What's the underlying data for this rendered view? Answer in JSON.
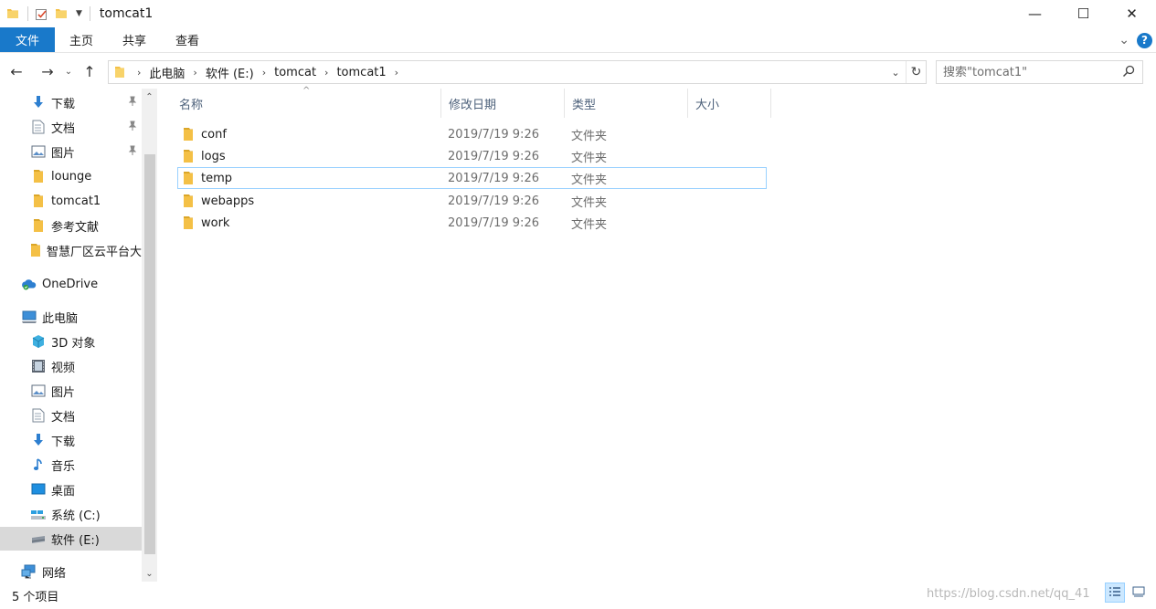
{
  "window": {
    "title": "tomcat1",
    "minimize_glyph": "—",
    "maximize_glyph": "☐",
    "close_glyph": "✕"
  },
  "ribbon": {
    "tabs": [
      {
        "label": "文件"
      },
      {
        "label": "主页"
      },
      {
        "label": "共享"
      },
      {
        "label": "查看"
      }
    ],
    "expand_glyph": "⌄",
    "help_glyph": "?"
  },
  "navigation": {
    "back_glyph": "←",
    "forward_glyph": "→",
    "recent_glyph": "⌄",
    "up_glyph": "↑"
  },
  "address": {
    "crumbs": [
      {
        "label": "此电脑"
      },
      {
        "label": "软件 (E:)"
      },
      {
        "label": "tomcat"
      },
      {
        "label": "tomcat1"
      }
    ],
    "separator": "›",
    "dropdown_glyph": "⌄",
    "refresh_glyph": "↻"
  },
  "search": {
    "placeholder": "搜索\"tomcat1\""
  },
  "sidebar": {
    "quick_access": [
      {
        "label": "下载",
        "icon": "download-icon",
        "pinned": true
      },
      {
        "label": "文档",
        "icon": "document-icon",
        "pinned": true
      },
      {
        "label": "图片",
        "icon": "picture-icon",
        "pinned": true
      },
      {
        "label": "lounge",
        "icon": "folder-icon"
      },
      {
        "label": "tomcat1",
        "icon": "folder-icon"
      },
      {
        "label": "参考文献",
        "icon": "folder-icon"
      },
      {
        "label": "智慧厂区云平台大",
        "icon": "folder-icon"
      }
    ],
    "onedrive": "OneDrive",
    "this_pc": "此电脑",
    "pc_items": [
      {
        "label": "3D 对象",
        "icon": "cube-icon"
      },
      {
        "label": "视频",
        "icon": "video-icon"
      },
      {
        "label": "图片",
        "icon": "picture-icon"
      },
      {
        "label": "文档",
        "icon": "document-icon"
      },
      {
        "label": "下载",
        "icon": "download-icon"
      },
      {
        "label": "音乐",
        "icon": "music-icon"
      },
      {
        "label": "桌面",
        "icon": "desktop-icon"
      },
      {
        "label": "系统 (C:)",
        "icon": "system-drive-icon"
      },
      {
        "label": "软件 (E:)",
        "icon": "drive-icon"
      }
    ],
    "network": "网络",
    "scroll_up_glyph": "⌃",
    "scroll_down_glyph": "⌄"
  },
  "columns": [
    {
      "label": "名称"
    },
    {
      "label": "修改日期"
    },
    {
      "label": "类型"
    },
    {
      "label": "大小"
    }
  ],
  "sort_glyph": "^",
  "files": [
    {
      "name": "conf",
      "date": "2019/7/19 9:26",
      "type": "文件夹"
    },
    {
      "name": "logs",
      "date": "2019/7/19 9:26",
      "type": "文件夹"
    },
    {
      "name": "temp",
      "date": "2019/7/19 9:26",
      "type": "文件夹"
    },
    {
      "name": "webapps",
      "date": "2019/7/19 9:26",
      "type": "文件夹"
    },
    {
      "name": "work",
      "date": "2019/7/19 9:26",
      "type": "文件夹"
    }
  ],
  "status": {
    "item_count": "5 个项目",
    "watermark": "https://blog.csdn.net/qq_41"
  },
  "colors": {
    "accent": "#1979ca",
    "folder": "#f4c046",
    "folder_dark": "#dba628",
    "selection": "#cce8ff",
    "focus_border": "#99d1ff"
  }
}
